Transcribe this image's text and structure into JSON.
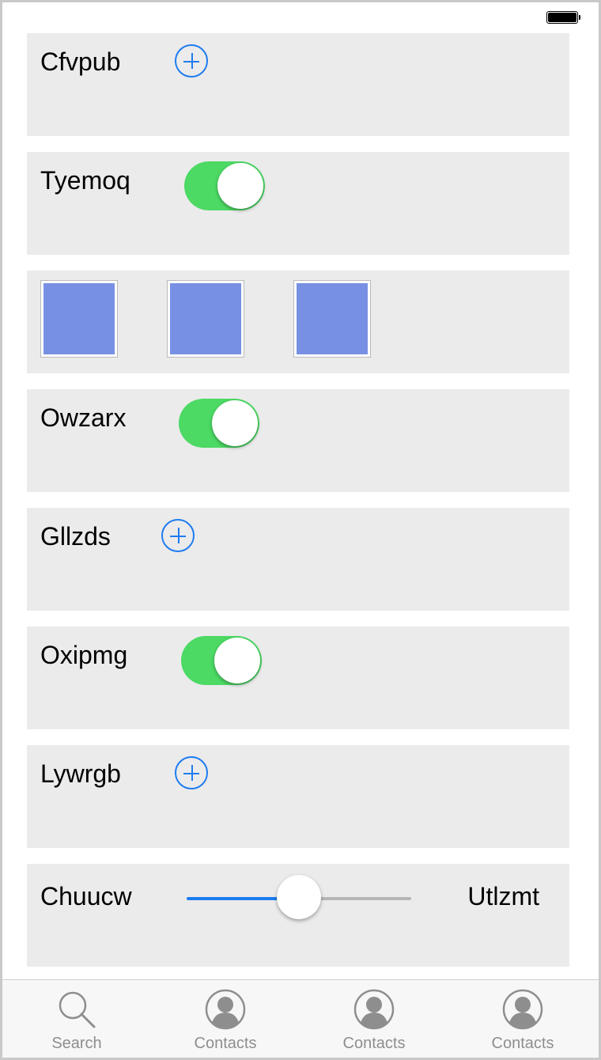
{
  "status_bar": {
    "battery_level": 1.0
  },
  "rows": [
    {
      "label": "Cfvpub",
      "control": "add-button",
      "icon": "plus-circle-icon"
    },
    {
      "label": "Tyemoq",
      "control": "toggle",
      "on": true
    },
    {
      "control": "image-swatches",
      "swatch_color": "#7890e4",
      "count": 3
    },
    {
      "label": "Owzarx",
      "control": "toggle",
      "on": true
    },
    {
      "label": "Gllzds",
      "control": "add-button",
      "icon": "plus-circle-icon"
    },
    {
      "label": "Oxipmg",
      "control": "toggle",
      "on": true
    },
    {
      "label": "Lywrgb",
      "control": "add-button",
      "icon": "plus-circle-icon"
    },
    {
      "label": "Chuucw",
      "control": "slider",
      "value_fraction": 0.5,
      "value_label": "Utlzmt"
    }
  ],
  "colors": {
    "accent": "#1e7cf0",
    "toggle_on": "#4cd964",
    "row_background": "#ebebeb",
    "swatch": "#7890e4"
  },
  "tabbar": {
    "items": [
      {
        "label": "Search",
        "icon": "search-icon"
      },
      {
        "label": "Contacts",
        "icon": "contact-icon"
      },
      {
        "label": "Contacts",
        "icon": "contact-icon"
      },
      {
        "label": "Contacts",
        "icon": "contact-icon"
      }
    ]
  }
}
